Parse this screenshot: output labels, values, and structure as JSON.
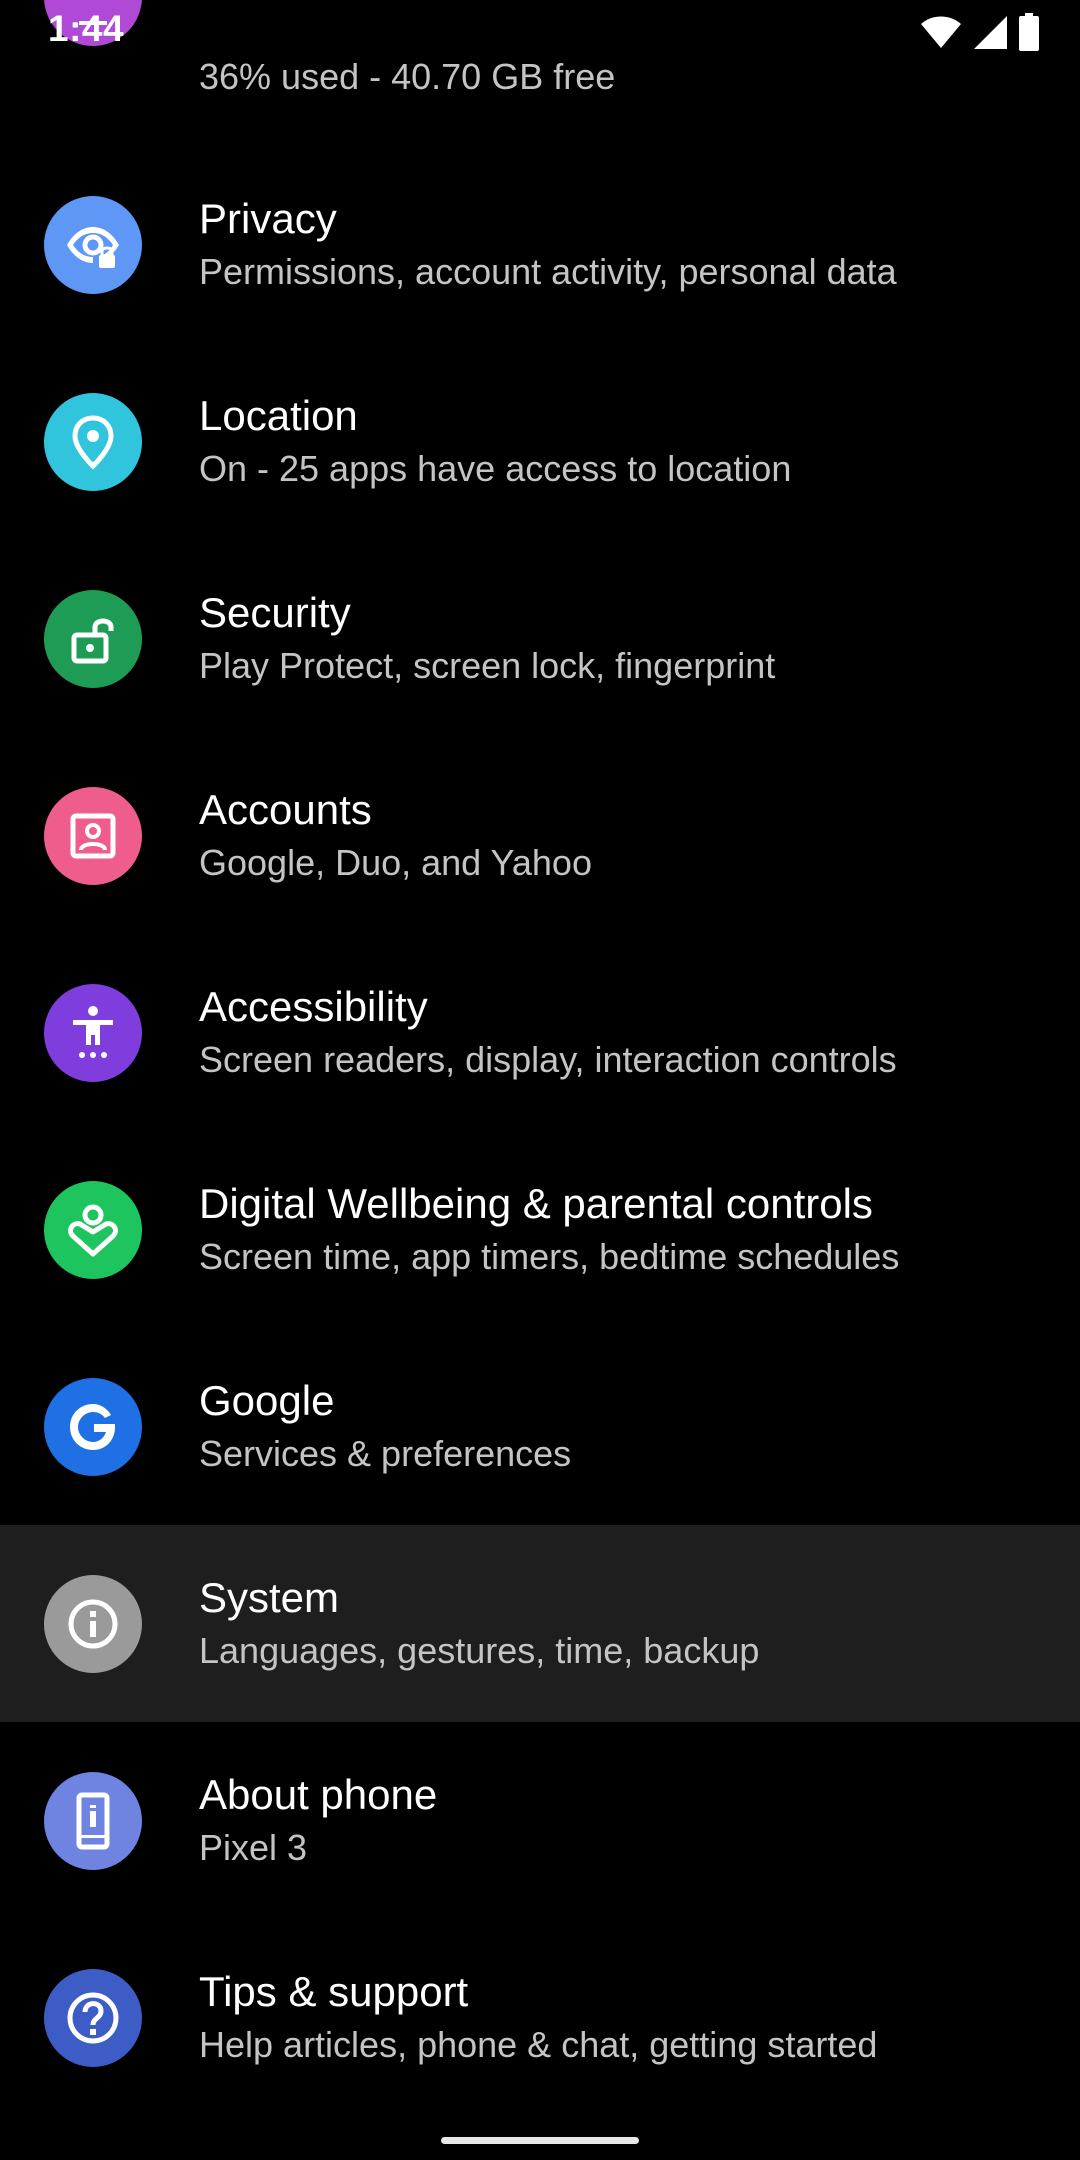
{
  "status_bar": {
    "time": "1:44",
    "icons": [
      "wifi-icon",
      "cell-signal-icon",
      "battery-icon"
    ]
  },
  "partial_item": {
    "subtitle": "36% used - 40.70 GB free",
    "icon": "storage-icon",
    "icon_color": "#b04ad6"
  },
  "settings": [
    {
      "title": "Privacy",
      "subtitle": "Permissions, account activity, personal data",
      "icon": "privacy-icon",
      "icon_color": "#5e97f6"
    },
    {
      "title": "Location",
      "subtitle": "On - 25 apps have access to location",
      "icon": "location-icon",
      "icon_color": "#30c5dd"
    },
    {
      "title": "Security",
      "subtitle": "Play Protect, screen lock, fingerprint",
      "icon": "security-icon",
      "icon_color": "#1e9c56"
    },
    {
      "title": "Accounts",
      "subtitle": "Google, Duo, and Yahoo",
      "icon": "accounts-icon",
      "icon_color": "#ef5d8c"
    },
    {
      "title": "Accessibility",
      "subtitle": "Screen readers, display, interaction controls",
      "icon": "accessibility-icon",
      "icon_color": "#7e3ddc"
    },
    {
      "title": "Digital Wellbeing & parental controls",
      "subtitle": "Screen time, app timers, bedtime schedules",
      "icon": "wellbeing-icon",
      "icon_color": "#1ec55e"
    },
    {
      "title": "Google",
      "subtitle": "Services & preferences",
      "icon": "google-icon",
      "icon_color": "#1f6fe5"
    },
    {
      "title": "System",
      "subtitle": "Languages, gestures, time, backup",
      "icon": "info-icon",
      "icon_color": "#9a9a9a",
      "selected": true
    },
    {
      "title": "About phone",
      "subtitle": "Pixel 3",
      "icon": "phone-icon",
      "icon_color": "#6e84e0"
    },
    {
      "title": "Tips & support",
      "subtitle": "Help articles, phone & chat, getting started",
      "icon": "help-icon",
      "icon_color": "#3e5cc5"
    }
  ],
  "colors": {
    "background": "#000000",
    "selected_row": "#1e1e1e",
    "title_text": "#ffffff",
    "subtitle_text": "#c4c4c4"
  }
}
